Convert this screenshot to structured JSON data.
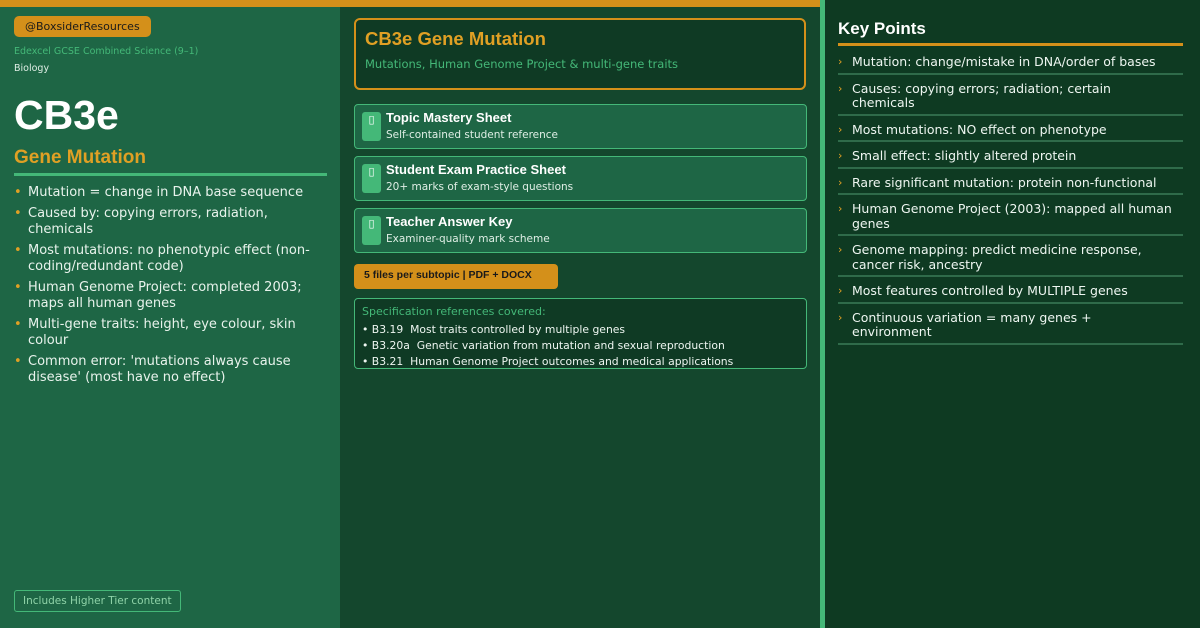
{
  "left": {
    "handle": "@BoxsiderResources",
    "course": "Edexcel GCSE Combined Science (9–1)",
    "subject": "Biology",
    "code": "CB3e",
    "topic": "Gene Mutation",
    "summary": [
      "Mutation = change in DNA base sequence",
      "Caused by: copying errors, radiation, chemicals",
      "Most mutations: no phenotypic effect (non-coding/redundant code)",
      "Human Genome Project: completed 2003; maps all human genes",
      "Multi-gene traits: height, eye colour, skin colour",
      "Common error: 'mutations always cause disease' (most have no effect)"
    ],
    "tier_badge": "Includes Higher Tier content"
  },
  "middle": {
    "title": "CB3e Gene Mutation",
    "subtitle": "Mutations, Human Genome Project & multi-gene traits",
    "files": [
      {
        "name": "Topic Mastery Sheet",
        "desc": "Self-contained student reference",
        "icon": "document-icon"
      },
      {
        "name": "Student Exam Practice Sheet",
        "desc": "20+ marks of exam-style questions",
        "icon": "document-icon"
      },
      {
        "name": "Teacher Answer Key",
        "desc": "Examiner-quality mark scheme",
        "icon": "document-icon"
      }
    ],
    "files_badge": "5 files per subtopic  |  PDF + DOCX",
    "spec": {
      "heading": "Specification references covered:",
      "items": [
        "• B3.19  Most traits controlled by multiple genes",
        "• B3.20a  Genetic variation from mutation and sexual reproduction",
        "• B3.21  Human Genome Project outcomes and medical applications"
      ]
    }
  },
  "right": {
    "title": "Key Points",
    "bullet": "›",
    "points": [
      "Mutation: change/mistake in DNA/order of bases",
      "Causes: copying errors; radiation; certain chemicals",
      "Most mutations: NO effect on phenotype",
      "Small effect: slightly altered protein",
      "Rare significant mutation: protein non-functional",
      "Human Genome Project (2003): mapped all human genes",
      "Genome mapping: predict medicine response, cancer risk, ancestry",
      "Most features controlled by MULTIPLE genes",
      "Continuous variation = many genes + environment"
    ]
  },
  "colors": {
    "accent_gold": "#d4901a",
    "accent_green": "#44b878",
    "panel_left": "#1e6645",
    "panel_mid": "#14472d",
    "panel_right": "#0e3a22"
  }
}
